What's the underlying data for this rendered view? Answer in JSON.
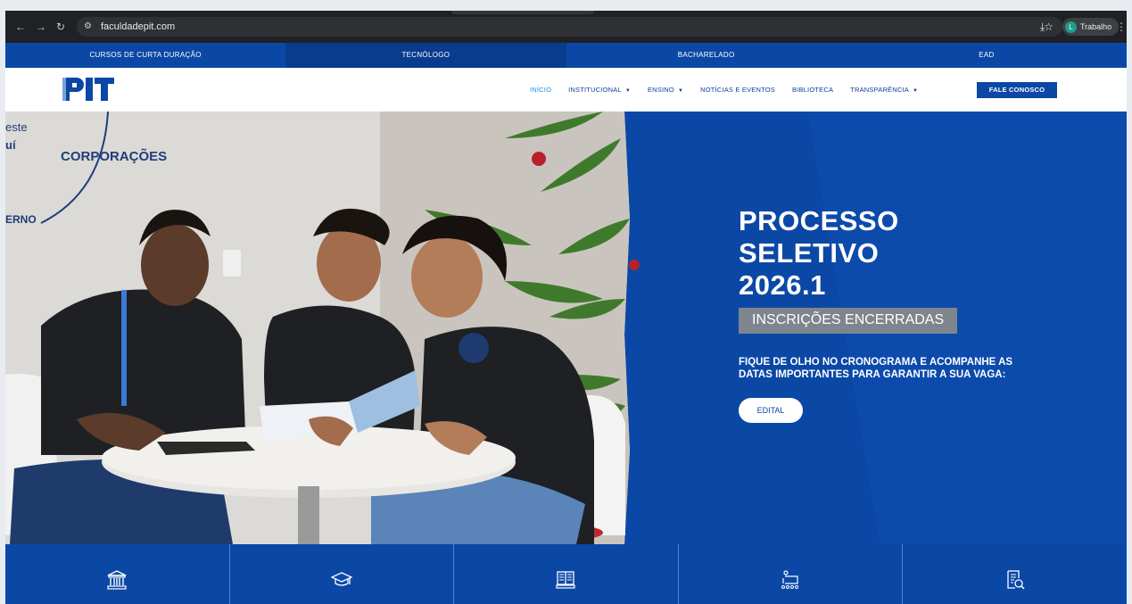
{
  "browser": {
    "url": "faculdadepit.com",
    "profile_name": "Trabalho",
    "profile_initial": "L",
    "icons": [
      "back-icon",
      "forward-icon",
      "reload-icon",
      "site-settings-icon",
      "star-icon",
      "download-icon",
      "menu-icon"
    ]
  },
  "categories": [
    {
      "label": "CURSOS DE CURTA DURAÇÃO"
    },
    {
      "label": "TECNÓLOGO"
    },
    {
      "label": "BACHARELADO"
    },
    {
      "label": "EAD"
    }
  ],
  "menu": [
    {
      "label": "INÍCIO"
    },
    {
      "label": "INSTITUCIONAL"
    },
    {
      "label": "ENSINO"
    },
    {
      "label": "NOTÍCIAS E EVENTOS"
    },
    {
      "label": "BIBLIOTECA"
    },
    {
      "label": "TRANSPARÊNCIA"
    }
  ],
  "cta_label": "FALE CONOSCO",
  "hero": {
    "title_line1": "PROCESSO",
    "title_line2": "SELETIVO",
    "title_line3": "2026.1",
    "tag": "INSCRIÇÕES ENCERRADAS",
    "description": "FIQUE DE OLHO NO CRONOGRAMA E ACOMPANHE AS DATAS IMPORTANTES PARA GARANTIR A SUA VAGA:",
    "button": "EDITAL",
    "wall_text_1": "CORPORAÇÕES",
    "wall_text_2": "ERNO",
    "wall_text_3": "este",
    "wall_text_4": "uí"
  },
  "quick_links_icons": [
    "institution-icon",
    "graduation-cap-icon",
    "book-icon",
    "diploma-icon",
    "document-search-icon"
  ],
  "colors": {
    "brand_blue": "#0b48a6",
    "accent_light_blue": "#1b8de0",
    "tag_gray": "#7f858d"
  }
}
